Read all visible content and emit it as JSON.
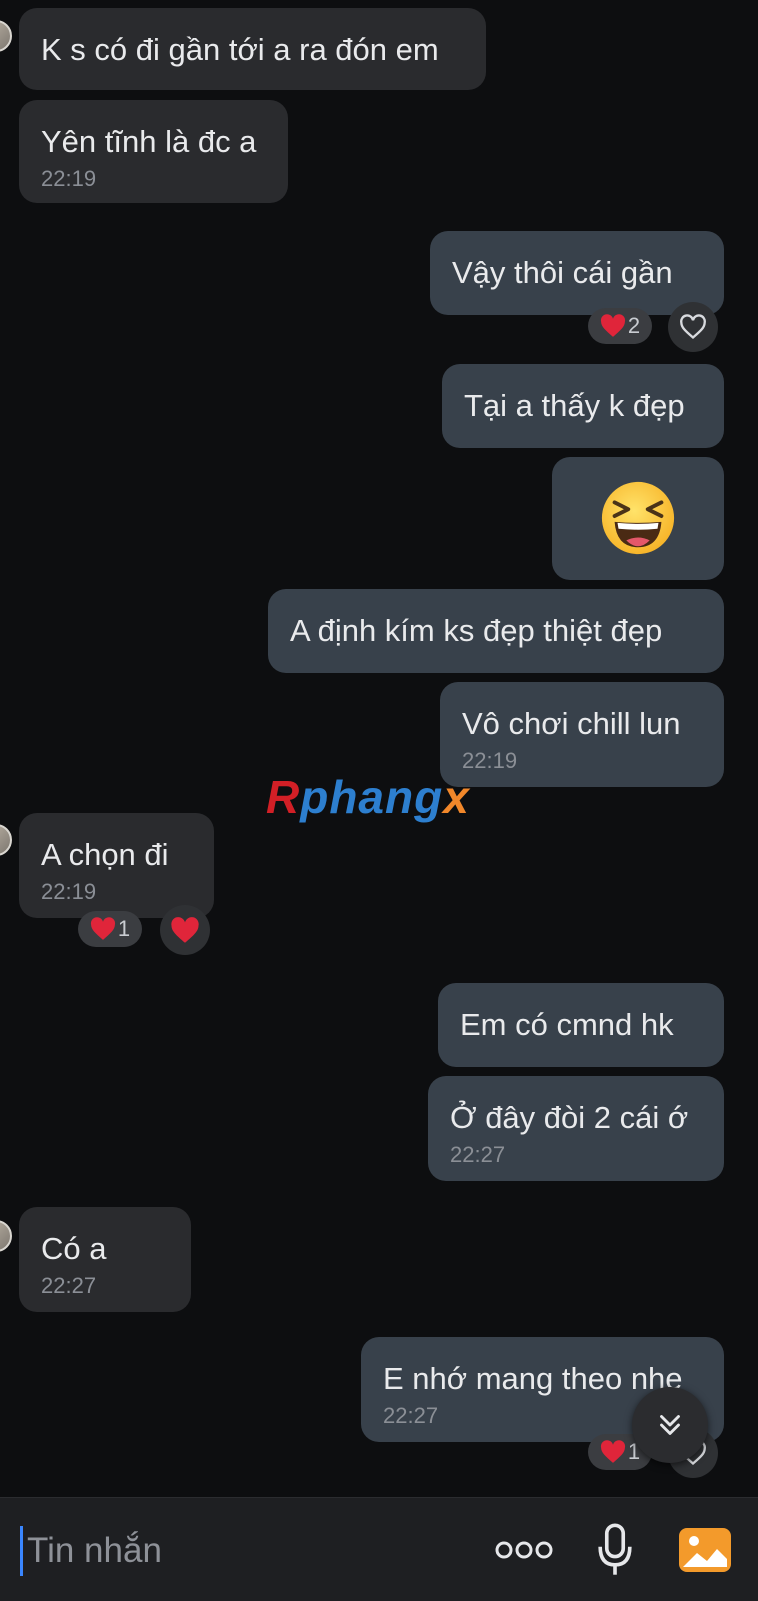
{
  "messages": [
    {
      "id": "m1",
      "text": "K s có đi gần tới a ra đón em",
      "time": ""
    },
    {
      "id": "m2",
      "text": "Yên tĩnh là đc a",
      "time": "22:19"
    },
    {
      "id": "m3",
      "text": "Vậy thôi cái gần",
      "time": "",
      "reaction_count": "2"
    },
    {
      "id": "m4",
      "text": "Tại a thấy k đẹp",
      "time": ""
    },
    {
      "id": "m5",
      "emoji": "laughing-face"
    },
    {
      "id": "m6",
      "text": "A định kím ks đẹp thiệt đẹp",
      "time": ""
    },
    {
      "id": "m7",
      "text": "Vô chơi chill lun",
      "time": "22:19"
    },
    {
      "id": "m8",
      "text": "A chọn đi",
      "time": "22:19",
      "reaction_count": "1"
    },
    {
      "id": "m9",
      "text": "Em có cmnd hk",
      "time": ""
    },
    {
      "id": "m10",
      "text": "Ở đây đòi 2 cái ớ",
      "time": "22:27"
    },
    {
      "id": "m11",
      "text": "Có a",
      "time": "22:27"
    },
    {
      "id": "m12",
      "text": "E nhớ mang theo nhe",
      "time": "22:27",
      "reaction_count": "1"
    }
  ],
  "watermark": {
    "part1": "R",
    "part2": "phang",
    "part3": "x"
  },
  "composer": {
    "placeholder": "Tin nhắn"
  },
  "colors": {
    "background": "#0d0e10",
    "incoming": "#2a2b2e",
    "outgoing": "#38414b",
    "heart": "#e0253a",
    "accent": "#3a86ff"
  }
}
